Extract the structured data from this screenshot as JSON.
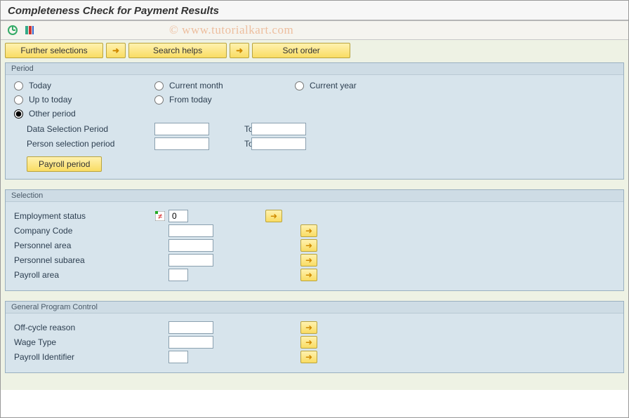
{
  "title": "Completeness Check for Payment Results",
  "watermark": "© www.tutorialkart.com",
  "toolbar": {
    "further_selections": "Further selections",
    "search_helps": "Search helps",
    "sort_order": "Sort order"
  },
  "period": {
    "legend": "Period",
    "radios": {
      "today": "Today",
      "current_month": "Current month",
      "current_year": "Current year",
      "up_to_today": "Up to today",
      "from_today": "From today",
      "other_period": "Other period"
    },
    "data_selection_label": "Data Selection Period",
    "person_selection_label": "Person selection period",
    "to_label": "To",
    "payroll_period_btn": "Payroll period"
  },
  "selection": {
    "legend": "Selection",
    "employment_status_label": "Employment status",
    "employment_status_value": "0",
    "company_code_label": "Company Code",
    "personnel_area_label": "Personnel area",
    "personnel_subarea_label": "Personnel subarea",
    "payroll_area_label": "Payroll area"
  },
  "general": {
    "legend": "General Program Control",
    "offcycle_label": "Off-cycle reason",
    "wage_type_label": "Wage Type",
    "payroll_id_label": "Payroll Identifier"
  },
  "colors": {
    "accent_btn": "#f9dc63",
    "panel_bg": "#d7e4ec"
  }
}
